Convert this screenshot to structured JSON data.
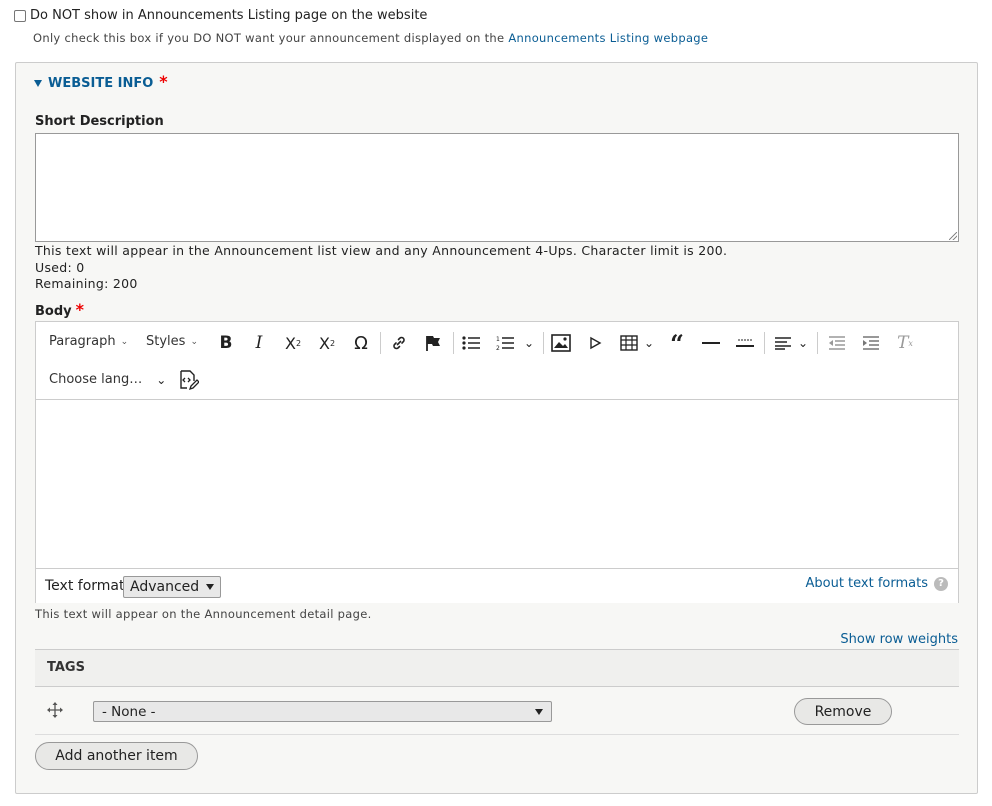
{
  "listing": {
    "checkbox_label": "Do NOT show in Announcements Listing page on the website",
    "hint_prefix": "Only check this box if you DO NOT want your announcement displayed on the ",
    "hint_link": "Announcements Listing webpage"
  },
  "website_info": {
    "legend": "WEBSITE INFO",
    "required_mark": "*",
    "short_description": {
      "label": "Short Description",
      "value": "",
      "help": "This text will appear in the Announcement list view and any Announcement 4-Ups. Character limit is 200.",
      "used": "Used: 0",
      "remaining": "Remaining: 200"
    },
    "body": {
      "label": "Body",
      "required_mark": "*",
      "toolbar": {
        "paragraph": "Paragraph",
        "styles": "Styles",
        "language": "Choose lang…",
        "caret": "⌄"
      },
      "text_format_label": "Text format",
      "text_format_value": "Advanced",
      "about_formats": "About text formats",
      "help_mark": "?",
      "help": "This text will appear on the Announcement detail page."
    },
    "show_row_weights": "Show row weights",
    "tags": {
      "header": "TAGS",
      "select_value": "- None -",
      "remove": "Remove",
      "add_another": "Add another item"
    }
  }
}
